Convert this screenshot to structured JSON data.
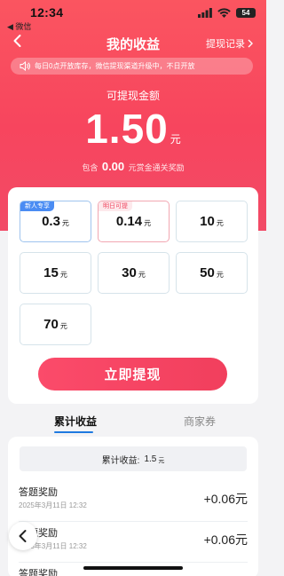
{
  "status_bar": {
    "time": "12:34",
    "back_app": "◀ 微信",
    "battery": "54"
  },
  "nav": {
    "title": "我的收益",
    "right_link": "提现记录"
  },
  "notice": {
    "text": "每日0点开放库存，微信提现渠道升级中，不日开放"
  },
  "balance": {
    "label": "可提现金额",
    "amount": "1.50",
    "unit": "元",
    "sub_prefix": "包含",
    "sub_amount": "0.00",
    "sub_suffix": "元赏金通关奖励"
  },
  "options": [
    {
      "value": "0.3",
      "unit": "元",
      "tag": "新人专享"
    },
    {
      "value": "0.14",
      "unit": "元",
      "tag": "明日可提"
    },
    {
      "value": "10",
      "unit": "元"
    },
    {
      "value": "15",
      "unit": "元"
    },
    {
      "value": "30",
      "unit": "元"
    },
    {
      "value": "50",
      "unit": "元"
    },
    {
      "value": "70",
      "unit": "元"
    }
  ],
  "withdraw_button": "立即提现",
  "tabs": [
    {
      "label": "累计收益",
      "active": true
    },
    {
      "label": "商家券",
      "active": false
    }
  ],
  "total": {
    "label": "累计收益:",
    "value": "1.5",
    "unit": "元"
  },
  "records": [
    {
      "title": "答题奖励",
      "date": "2025年3月11日 12:32",
      "amount": "+0.06元"
    },
    {
      "title": "答题奖励",
      "date": "2025年3月11日 12:32",
      "amount": "+0.06元"
    },
    {
      "title": "答题奖励",
      "date": "",
      "amount": ""
    }
  ],
  "colors": {
    "hero": "#f7455e",
    "button": "#f13f5d",
    "tab_underline": "#1f7ae0",
    "tag_blue": "#4a8cf3"
  }
}
